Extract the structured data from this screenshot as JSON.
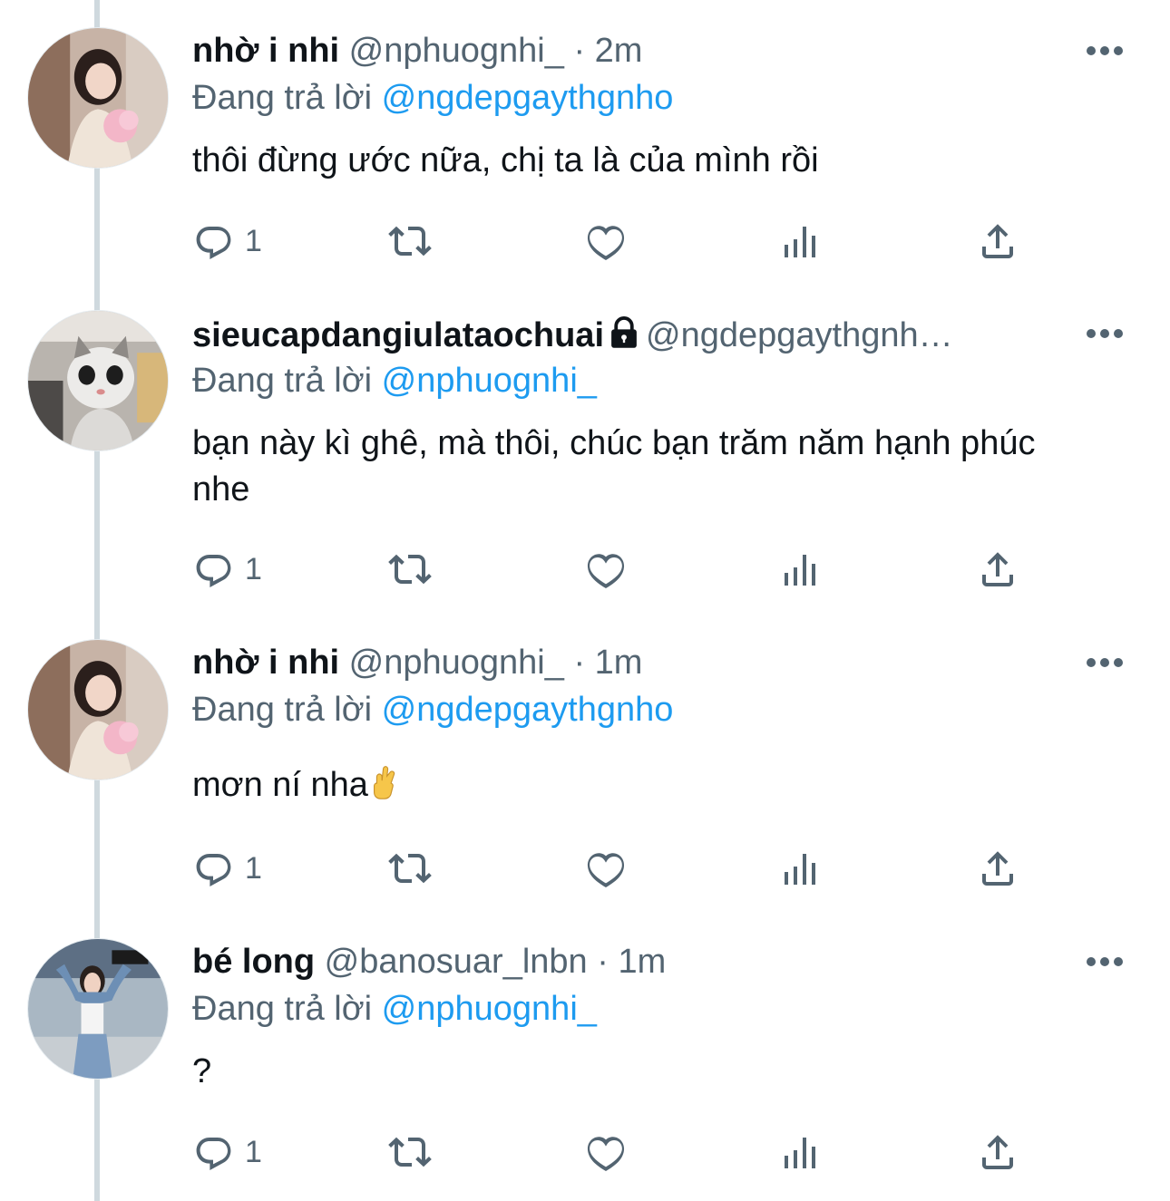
{
  "tweets": [
    {
      "name": "nhờ i nhi",
      "handle": "@nphuognhi_",
      "dot": "·",
      "time": "2m",
      "reply_prefix": "Đang trả lời",
      "reply_to": "@ngdepgaythgnho",
      "text": "thôi đừng ước nữa, chị ta là của mình rồi",
      "reply_count": "1"
    },
    {
      "name": "sieucapdangiulataochuai",
      "handle": "@ngdepgaythgnh…",
      "reply_prefix": "Đang trả lời",
      "reply_to": "@nphuognhi_",
      "text": "bạn này kì ghê, mà thôi, chúc bạn trăm năm hạnh phúc nhe",
      "reply_count": "1"
    },
    {
      "name": "nhờ i nhi",
      "handle": "@nphuognhi_",
      "dot": "·",
      "time": "1m",
      "reply_prefix": "Đang trả lời",
      "reply_to": "@ngdepgaythgnho",
      "text": "mơn ní nha",
      "reply_count": "1"
    },
    {
      "name": "bé long",
      "handle": "@banosuar_lnbn",
      "dot": "·",
      "time": "1m",
      "reply_prefix": "Đang trả lời",
      "reply_to": "@nphuognhi_",
      "text": "?",
      "reply_count": "1"
    }
  ],
  "colors": {
    "text": "#0f1419",
    "secondary": "#536471",
    "link": "#1d9bf0",
    "thread_line": "#cfd9de"
  },
  "icons": [
    "reply-icon",
    "retweet-icon",
    "like-icon",
    "views-icon",
    "share-icon",
    "more-icon",
    "lock-icon",
    "hand-emoji-icon"
  ]
}
